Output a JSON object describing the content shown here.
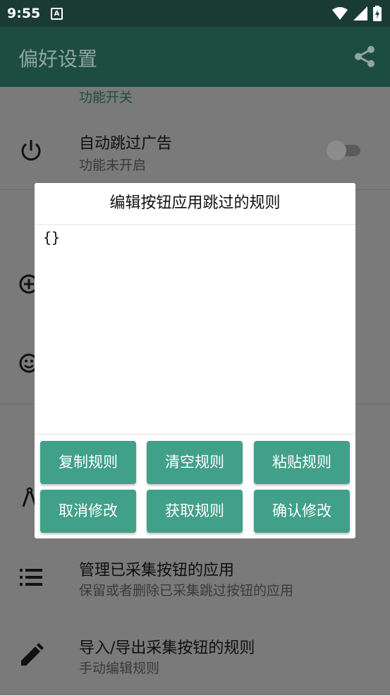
{
  "status": {
    "time": "9:55",
    "a_label": "A"
  },
  "appbar": {
    "title": "偏好设置",
    "share_icon": "share-icon"
  },
  "settings": {
    "section_title": "功能开关",
    "items": [
      {
        "title": "自动跳过广告",
        "subtitle": "功能未开启",
        "icon": "power-icon"
      },
      {
        "title": "管理已采集按钮的应用",
        "subtitle": "保留或者删除已采集跳过按钮的应用",
        "icon": "list-icon"
      },
      {
        "title": "导入/导出采集按钮的规则",
        "subtitle": "手动编辑规则",
        "icon": "pencil-icon"
      }
    ]
  },
  "dialog": {
    "title": "编辑按钮应用跳过的规则",
    "editor_value": "{}",
    "buttons": [
      "复制规则",
      "清空规则",
      "粘贴规则",
      "取消修改",
      "获取规则",
      "确认修改"
    ]
  },
  "colors": {
    "accent": "#41a089",
    "appbar": "#1d4d40",
    "statusbar": "#1a3b33"
  }
}
